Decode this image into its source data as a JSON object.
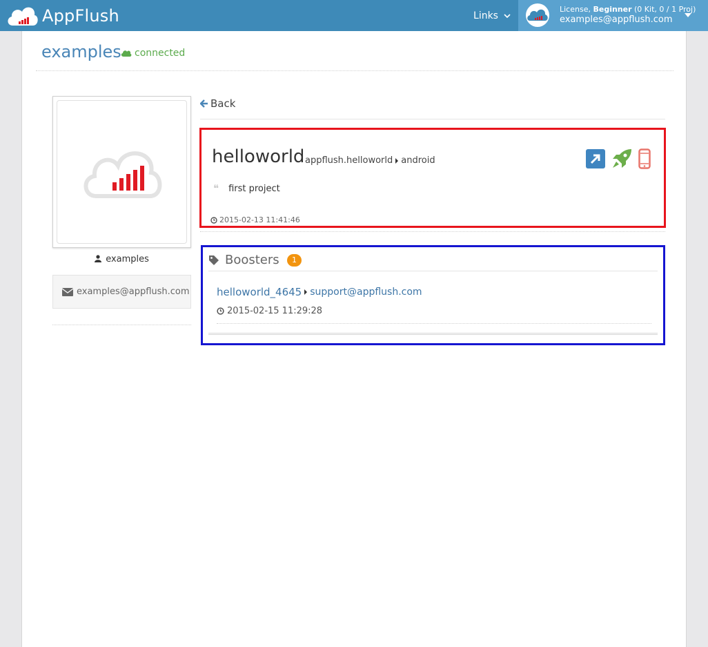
{
  "navbar": {
    "brand": "AppFlush",
    "links_label": "Links",
    "license_prefix": "License, ",
    "license_level": "Beginner",
    "license_suffix": " (0 Kit, 0 / 1 Proj)",
    "user_email": "examples@appflush.com",
    "color": "#3e8ab8",
    "user_color": "#5aa2cf"
  },
  "page": {
    "title": "examples",
    "status": "connected",
    "status_color": "#5cab4d"
  },
  "profile": {
    "username": "examples",
    "email": "examples@appflush.com",
    "icons": [
      "user-icon",
      "envelope-icon"
    ]
  },
  "back_label": "Back",
  "project": {
    "name": "helloworld",
    "package": "appflush.helloworld",
    "platform": "android",
    "description": "first project",
    "date": "2015-02-13 11:41:46",
    "actions": [
      "open-external-icon",
      "rocket-icon",
      "mobile-icon"
    ]
  },
  "boosters": {
    "title": "Boosters",
    "count": "1",
    "items": [
      {
        "name": "helloworld_4645",
        "email": "support@appflush.com",
        "date": "2015-02-15 11:29:28"
      }
    ]
  }
}
